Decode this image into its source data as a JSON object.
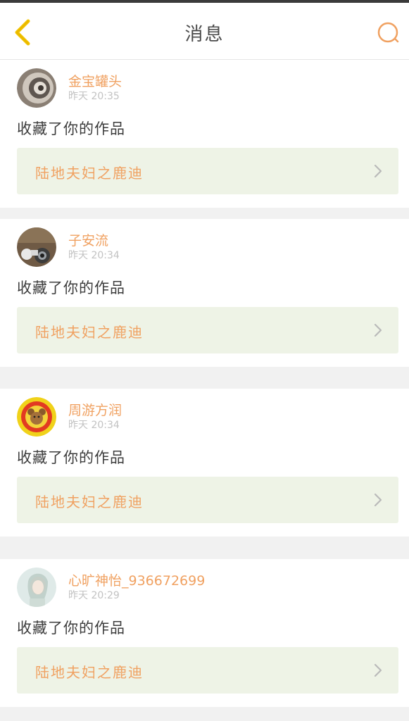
{
  "header": {
    "title": "消息"
  },
  "colors": {
    "accent": "#f0a161",
    "back_arrow": "#f2c400",
    "card_bg": "#eef3e6",
    "page_bg": "#f1f1f1"
  },
  "icons": {
    "back": "chevron-left-icon",
    "search": "search-icon",
    "link_arrow": "chevron-right-icon"
  },
  "messages": [
    {
      "user": "金宝罐头",
      "time": "昨天 20:35",
      "action": "收藏了你的作品",
      "work": "陆地夫妇之鹿迪"
    },
    {
      "user": "子安流",
      "time": "昨天 20:34",
      "action": "收藏了你的作品",
      "work": "陆地夫妇之鹿迪"
    },
    {
      "user": "周游方润",
      "time": "昨天 20:34",
      "action": "收藏了你的作品",
      "work": "陆地夫妇之鹿迪"
    },
    {
      "user": "心旷神怡_936672699",
      "time": "昨天 20:29",
      "action": "收藏了你的作品",
      "work": "陆地夫妇之鹿迪"
    }
  ]
}
